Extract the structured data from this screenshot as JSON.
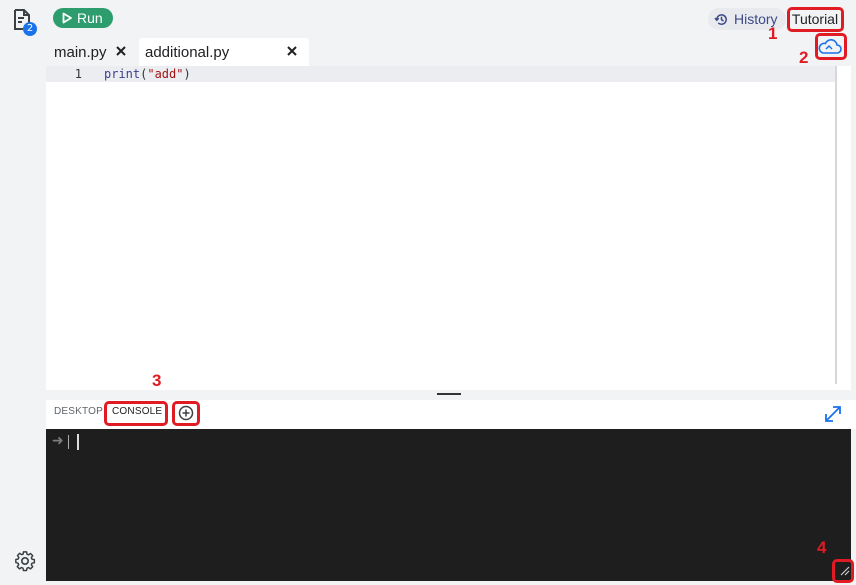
{
  "sidebar": {
    "files_icon": "file-icon",
    "files_badge": "2",
    "settings_icon": "gear-icon"
  },
  "toolbar": {
    "run_label": "Run",
    "run_icon": "play-icon",
    "history_label": "History",
    "history_icon": "history-icon",
    "tutorial_label": "Tutorial"
  },
  "tabs": [
    {
      "label": "main.py",
      "active": false
    },
    {
      "label": "additional.py",
      "active": true
    }
  ],
  "editor": {
    "line_number": "1",
    "code": {
      "fn": "print",
      "open": "(",
      "str": "\"add\"",
      "close": ")"
    }
  },
  "console": {
    "tabs": [
      "DESKTOP",
      "CONSOLE"
    ],
    "active_tab": "CONSOLE",
    "prompt_symbol": "➜"
  },
  "annotations": [
    "1",
    "2",
    "3",
    "4"
  ],
  "colors": {
    "run": "#2e9d6d",
    "annotation": "#e01b24",
    "terminal_bg": "#1e1e1e",
    "accent": "#1a73e8"
  }
}
